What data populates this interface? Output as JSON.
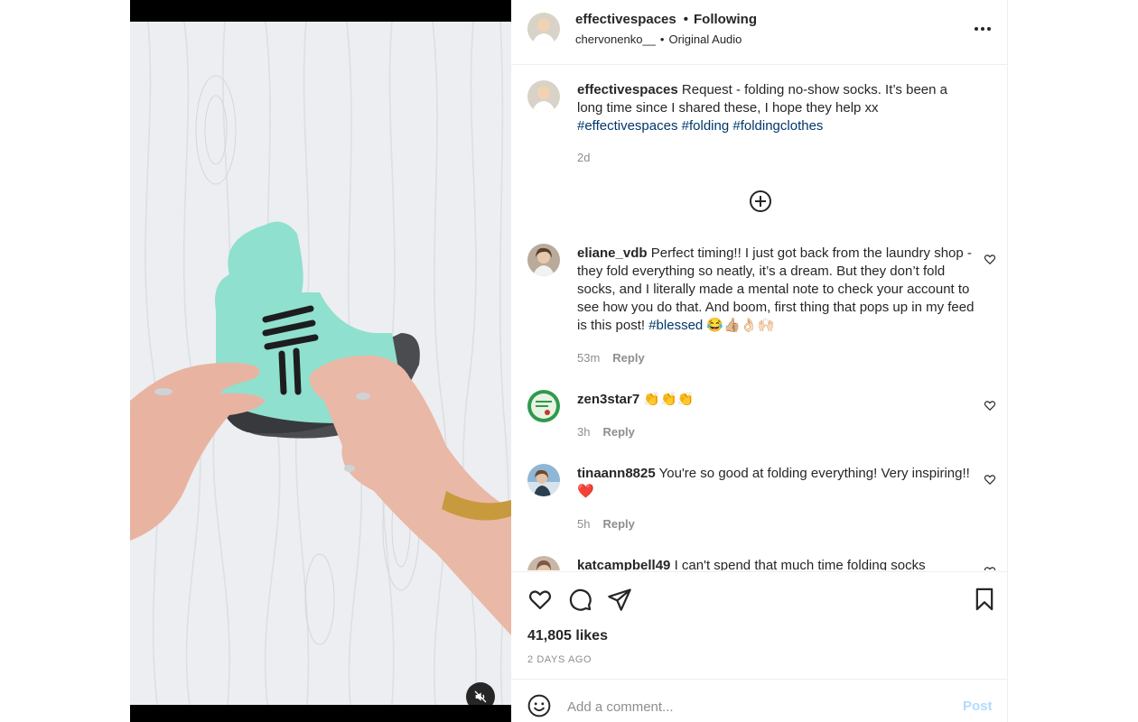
{
  "header": {
    "username": "effectivespaces",
    "separator": "•",
    "follow_status": "Following",
    "audio_author": "chervonenko__",
    "audio_separator": "•",
    "audio_label": "Original Audio"
  },
  "caption": {
    "username": "effectivespaces",
    "text": "Request - folding no-show socks. It’s been a long time since I shared these, I hope they help xx",
    "hashtags": [
      "#effectivespaces",
      "#folding",
      "#foldingclothes"
    ],
    "time": "2d"
  },
  "comments": [
    {
      "username": "eliane_vdb",
      "text": "Perfect timing!! I just got back from the laundry shop - they fold everything so neatly, it’s a dream. But they don’t fold socks, and I literally made a mental note to check your account to see how you do that. And boom, first thing that pops up in my feed is this post!",
      "hashtag": "#blessed",
      "emoji": "😂👍🏼👌🏻🙌🏻",
      "time": "53m",
      "reply_label": "Reply"
    },
    {
      "username": "zen3star7",
      "text": "👏👏👏",
      "time": "3h",
      "reply_label": "Reply"
    },
    {
      "username": "tinaann8825",
      "text": "You're so good at folding everything! Very inspiring!!❤️",
      "time": "5h",
      "reply_label": "Reply"
    },
    {
      "username": "katcampbell49",
      "text": "I can't spend that much time folding socks"
    }
  ],
  "stats": {
    "likes": "41,805 likes",
    "posted": "2 DAYS AGO"
  },
  "composer": {
    "placeholder": "Add a comment...",
    "post_label": "Post"
  },
  "colors": {
    "link": "#00376b",
    "muted": "#8e8e8e",
    "post_disabled": "#b3dbff",
    "sock": "#8fe0cf"
  },
  "icons": [
    "more-icon",
    "add-circle-icon",
    "heart-icon",
    "comment-icon",
    "share-icon",
    "save-icon",
    "emoji-icon",
    "mute-icon"
  ]
}
